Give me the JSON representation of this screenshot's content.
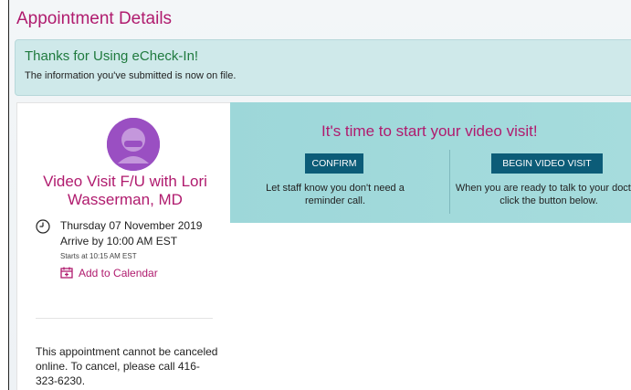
{
  "page": {
    "title": "Appointment Details"
  },
  "banner": {
    "title": "Thanks for Using eCheck-In!",
    "message": "The information you've submitted is now on file."
  },
  "appointment": {
    "avatar_icon": "user-avatar-icon",
    "title": "Video Visit F/U with Lori Wasserman, MD",
    "date": "Thursday 07 November 2019",
    "arrive": "Arrive by 10:00 AM EST",
    "starts": "Starts at 10:15 AM EST",
    "add_calendar": "Add to Calendar",
    "cancel_note": "This appointment cannot be canceled online. To cancel, please call 416-323-6230."
  },
  "video": {
    "heading": "It's time to start your video visit!",
    "confirm_label": "CONFIRM",
    "confirm_desc": "Let staff know you don't need a reminder call.",
    "begin_label": "BEGIN VIDEO VISIT",
    "begin_desc": "When you are ready to talk to your doctor, click the button below."
  },
  "colors": {
    "accent": "#b01b6e",
    "button": "#0c5c78",
    "banner_bg": "#cfe9ea",
    "panel_bg": "#a6dcdd",
    "success_text": "#1f7a3e"
  }
}
